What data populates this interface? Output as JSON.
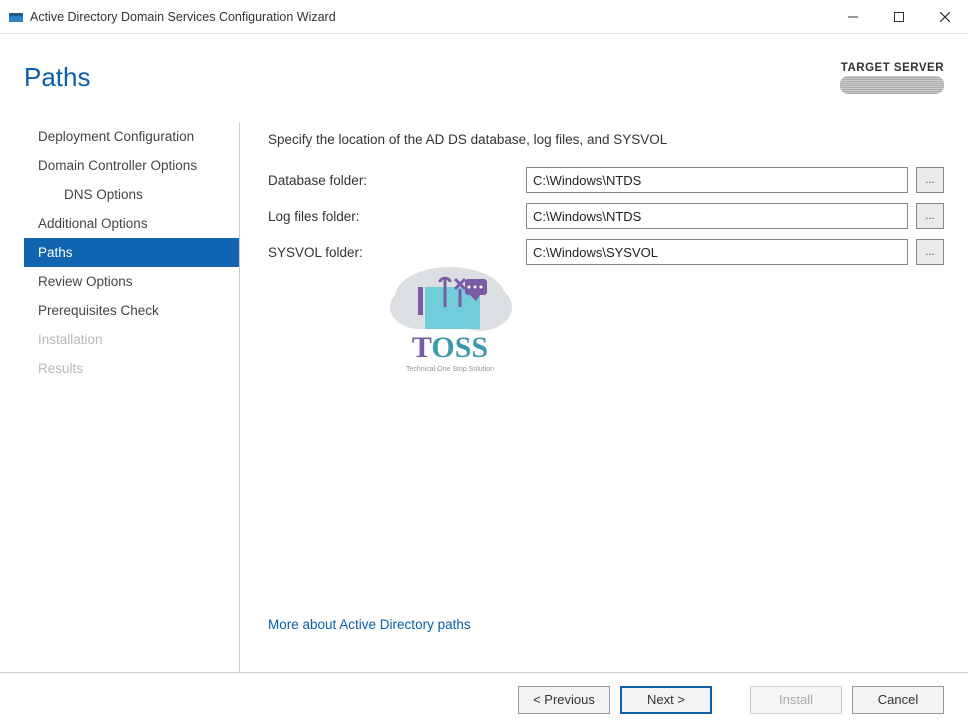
{
  "window": {
    "title": "Active Directory Domain Services Configuration Wizard"
  },
  "header": {
    "page_title": "Paths",
    "target_label": "TARGET SERVER"
  },
  "sidebar": {
    "items": [
      {
        "label": "Deployment Configuration",
        "state": "normal"
      },
      {
        "label": "Domain Controller Options",
        "state": "normal"
      },
      {
        "label": "DNS Options",
        "state": "sub"
      },
      {
        "label": "Additional Options",
        "state": "normal"
      },
      {
        "label": "Paths",
        "state": "active"
      },
      {
        "label": "Review Options",
        "state": "normal"
      },
      {
        "label": "Prerequisites Check",
        "state": "normal"
      },
      {
        "label": "Installation",
        "state": "disabled"
      },
      {
        "label": "Results",
        "state": "disabled"
      }
    ]
  },
  "content": {
    "instruction": "Specify the location of the AD DS database, log files, and SYSVOL",
    "fields": {
      "database": {
        "label": "Database folder:",
        "value": "C:\\Windows\\NTDS",
        "browse": "..."
      },
      "logfiles": {
        "label": "Log files folder:",
        "value": "C:\\Windows\\NTDS",
        "browse": "..."
      },
      "sysvol": {
        "label": "SYSVOL folder:",
        "value": "C:\\Windows\\SYSVOL",
        "browse": "..."
      }
    },
    "more_link": "More about Active Directory paths",
    "watermark": {
      "title": "TOSS",
      "subtitle": "Technical One Stop Solution"
    }
  },
  "footer": {
    "previous": "< Previous",
    "next": "Next >",
    "install": "Install",
    "cancel": "Cancel"
  }
}
